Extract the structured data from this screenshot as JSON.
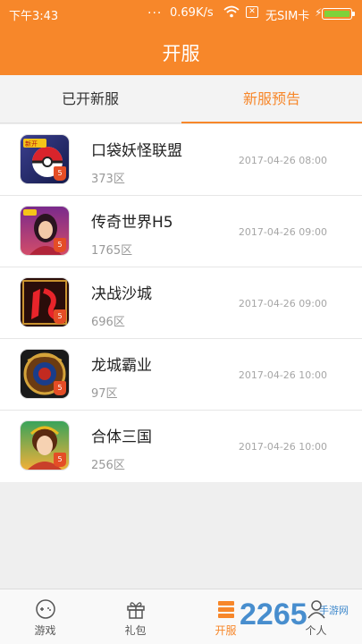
{
  "status": {
    "time": "下午3:43",
    "dots": "...",
    "speed": "0.69K/s",
    "sim_box": "✕",
    "sim": "无SIM卡"
  },
  "header": {
    "title": "开服"
  },
  "tabs": [
    {
      "label": "已开新服",
      "active": false
    },
    {
      "label": "新服预告",
      "active": true
    }
  ],
  "games": [
    {
      "name": "口袋妖怪联盟",
      "zone": "373区",
      "time": "2017-04-26 08:00",
      "icon": "pokeball-game-icon"
    },
    {
      "name": "传奇世界H5",
      "zone": "1765区",
      "time": "2017-04-26 09:00",
      "icon": "legend-heroine-game-icon"
    },
    {
      "name": "决战沙城",
      "zone": "696区",
      "time": "2017-04-26 09:00",
      "icon": "sand-city-game-icon"
    },
    {
      "name": "龙城霸业",
      "zone": "97区",
      "time": "2017-04-26 10:00",
      "icon": "dragon-city-game-icon"
    },
    {
      "name": "合体三国",
      "zone": "256区",
      "time": "2017-04-26 10:00",
      "icon": "three-kingdoms-game-icon"
    }
  ],
  "h5_badge": "5",
  "bottom_nav": [
    {
      "label": "游戏",
      "icon": "gamepad-icon"
    },
    {
      "label": "礼包",
      "icon": "gift-icon"
    },
    {
      "label": "开服",
      "icon": "server-icon",
      "active": true
    },
    {
      "label": "个人",
      "icon": "person-icon"
    }
  ],
  "watermark": {
    "text": "2265",
    "sub": "手游网"
  },
  "colors": {
    "accent": "#f7872a",
    "battery": "#7ed23a"
  }
}
